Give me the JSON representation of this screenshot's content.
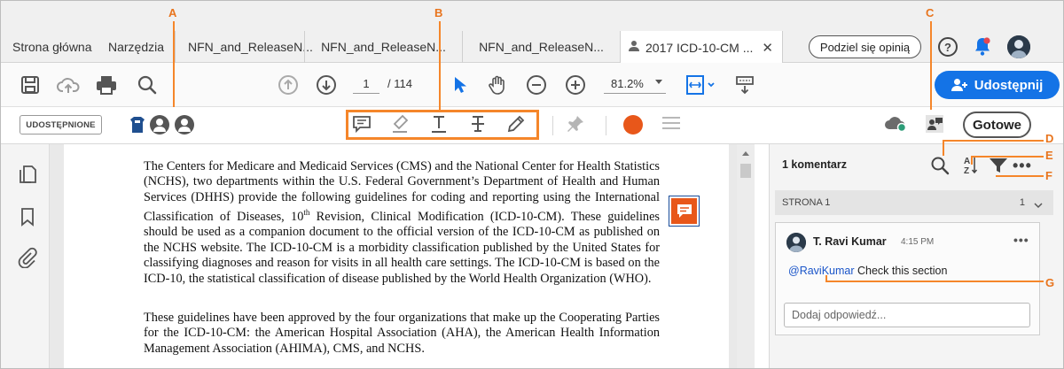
{
  "tabs": {
    "home": "Strona główna",
    "tools": "Narzędzia",
    "doc1": "NFN_and_ReleaseN...",
    "doc2": "NFN_and_ReleaseN...",
    "doc3": "NFN_and_ReleaseN...",
    "active": "2017 ICD-10-CM ..."
  },
  "topbar": {
    "feedback_label": "Podziel się opinią",
    "help_glyph": "?"
  },
  "toolbar": {
    "page_current": "1",
    "page_total": "/  114",
    "zoom": "81.2%",
    "share_label": "Udostępnij"
  },
  "comment_toolbar": {
    "shared_label": "UDOSTĘPNIONE",
    "done_label": "Gotowe"
  },
  "document": {
    "para1": "The Centers for Medicare and Medicaid Services (CMS) and the National Center for Health Statistics (NCHS), two departments within the U.S. Federal Government’s Department of Health and Human Services (DHHS) provide the following guidelines for coding and reporting using the International Classification of Diseases, 10",
    "para1_sup": "th",
    "para1_rest": " Revision, Clinical Modification (ICD-10-CM). These guidelines should be used as a companion document to the official version of the ICD-10-CM as published on the NCHS website. The ICD-10-CM is a morbidity classification published by the United States for classifying diagnoses and reason for visits in all health care settings.  The ICD-10-CM is based on the ICD-10, the statistical classification of disease published by the World Health Organization (WHO).",
    "para2": "These guidelines have been approved by the four organizations that make up the Cooperating Parties for the ICD-10-CM: the American Hospital Association (AHA), the American Health Information Management Association (AHIMA), CMS, and NCHS."
  },
  "comments_panel": {
    "title": "1 komentarz",
    "more": "•••",
    "page_label": "STRONA 1",
    "page_count": "1",
    "comment": {
      "author": "T. Ravi Kumar",
      "time": "4:15 PM",
      "more": "•••",
      "mention": "@RaviKumar",
      "text": " Check this section",
      "reply_placeholder": "Dodaj odpowiedź..."
    }
  },
  "callouts": {
    "A": "A",
    "B": "B",
    "C": "C",
    "D": "D",
    "E": "E",
    "F": "F",
    "G": "G"
  },
  "colors": {
    "accent": "#1473e6",
    "callout": "#f5862a",
    "markup": "#e8571a"
  }
}
